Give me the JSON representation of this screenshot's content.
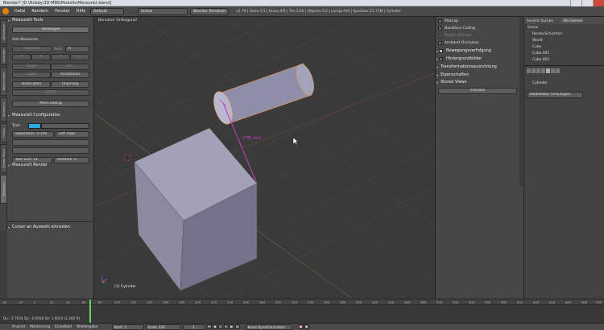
{
  "window": {
    "title": "Blender* [D:\\Hobby\\3D-MBS\\Modelle\\Messunkt.blend]"
  },
  "menu": [
    "Datei",
    "Rendern",
    "Fenster",
    "Hilfe"
  ],
  "header": {
    "layout": "Default",
    "scene": "Scene",
    "engine": "Blender Renderer",
    "stats": "v2.79 | Verts:7/1 | Faces:4/0 | Tris:1/30 | Objects:1/2 | Lamps:0/0 | Speicher:21.71M | Cylinder"
  },
  "tool_tabs": [
    "Werkzeuge",
    "Erzeugen",
    "Beziehungen",
    "Animation",
    "Physik",
    "Grease Pencil",
    "Measureit"
  ],
  "measureit": {
    "tools_title": "MeasureIt Tools",
    "show_button": "Verbergen",
    "add_title": "Add Measures",
    "segment_label": "Segment",
    "sum_label": "Sum",
    "sum_value": "A",
    "row1": [
      "A",
      "X",
      "Y",
      "Z"
    ],
    "angle_label": "Angle",
    "arc_label": "Arc",
    "label_label": "Label",
    "annotation_label": "Annotation",
    "link_label": "Verknüpfen",
    "origin_label": "Ursprung",
    "area_label": "Fläche",
    "debug_label": "Mesh Debug",
    "config_title": "MeasureIt Configuration",
    "text_label": "Text:",
    "separation_label": "Separation",
    "separation_value": "0.100",
    "align_value": "Left Align",
    "textsize_label": "Text Size",
    "textsize_value": "14",
    "rotation_label": "Rotation",
    "rotation_value": "0",
    "render_title": "MeasureIt Render",
    "operator_panel": "Cursor an Auswahl einrasten",
    "accent_color": "#2ea8e0"
  },
  "viewport": {
    "view_label": "Benutzer Orthogonal",
    "measurement": "2781 mm",
    "object_label": "(1) Cylinder",
    "measure_color": "#c43ec4"
  },
  "properties": {
    "items": [
      {
        "label": "Matcap",
        "state": "off"
      },
      {
        "label": "Backface Culling",
        "state": "off"
      },
      {
        "label": "Depth Of Field",
        "state": "dim"
      },
      {
        "label": "Ambient Occlusion",
        "state": "off"
      }
    ],
    "sections": [
      "Bewegungsverfolgung",
      "Hintergrundbilder",
      "Transformationsausrichtung",
      "Eigenschaften",
      "Stored Views"
    ],
    "initialize_button": "Initialize"
  },
  "outliner": {
    "tabs": [
      "Ansicht",
      "Suchen",
      "Alle Szenen"
    ],
    "rows": [
      "Scene",
      "RenderSchichten",
      "World",
      "Cube",
      "Cube.001",
      "Cube.002"
    ],
    "object_name": "Cylinder",
    "modifier_button": "Modifikator hinzufügen"
  },
  "timeline": {
    "ruler": [
      "-40",
      "-20",
      "0",
      "20",
      "40",
      "60",
      "80",
      "100",
      "120",
      "140",
      "160",
      "180",
      "200",
      "220",
      "240",
      "260",
      "280",
      "300",
      "320",
      "340",
      "360",
      "380",
      "400",
      "420",
      "440",
      "460",
      "480",
      "500",
      "520",
      "540",
      "560",
      "580",
      "600",
      "620",
      "640",
      "660",
      "680",
      "700"
    ],
    "marker_info": "Dx: -2.7634  Dy: -0.0058  Dz: 1.0034 (2.285 ft)"
  },
  "statusbar": {
    "menus": [
      "Ansicht",
      "Markierung",
      "Einzelbild",
      "Wiedergabe"
    ],
    "start_label": "Start:",
    "start_value": "1",
    "end_label": "Ende:",
    "end_value": "250",
    "frame_value": "1",
    "sync_value": "Keine Synchronisation"
  }
}
